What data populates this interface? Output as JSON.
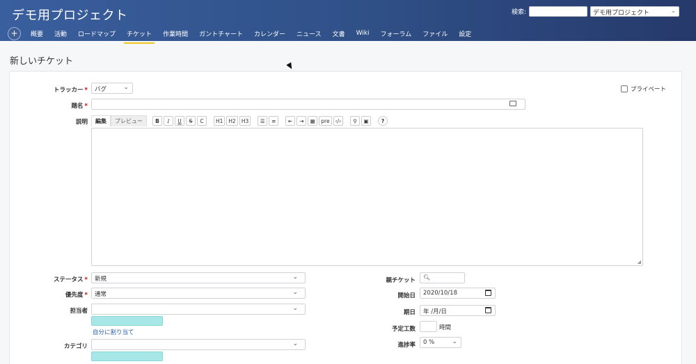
{
  "header": {
    "project_title": "デモ用プロジェクト",
    "search_label": "検索:",
    "search_value": "",
    "project_jump": "デモ用プロジェクト"
  },
  "menu": {
    "new_icon": "plus-icon",
    "items": [
      "概要",
      "活動",
      "ロードマップ",
      "チケット",
      "作業時間",
      "ガントチャート",
      "カレンダー",
      "ニュース",
      "文書",
      "Wiki",
      "フォーラム",
      "ファイル",
      "設定"
    ],
    "selected": "チケット"
  },
  "page": {
    "title": "新しいチケット"
  },
  "form": {
    "tracker_label": "トラッカー",
    "tracker_value": "バグ",
    "private_label": "プライベート",
    "subject_label": "題名",
    "subject_value": "",
    "description_label": "説明",
    "tab_edit": "編集",
    "tab_preview": "プレビュー",
    "toolbar": {
      "bold": "B",
      "italic": "I",
      "underline": "U",
      "strike": "S",
      "code": "C",
      "h1": "H1",
      "h2": "H2",
      "h3": "H3",
      "pre": "pre"
    },
    "status_label": "ステータス",
    "status_value": "新規",
    "priority_label": "優先度",
    "priority_value": "通常",
    "assignee_label": "担当者",
    "assignee_value": "",
    "assign_to_me": "自分に割り当て",
    "category_label": "カテゴリ",
    "category_value": "",
    "parent_label": "親チケット",
    "parent_value": "",
    "start_label": "開始日",
    "start_value": "2020/10/18",
    "due_label": "期日",
    "due_value": "年 /月/日",
    "estimated_label": "予定工数",
    "estimated_value": "",
    "hours_unit": "時間",
    "done_label": "進捗率",
    "done_value": "0 %"
  }
}
